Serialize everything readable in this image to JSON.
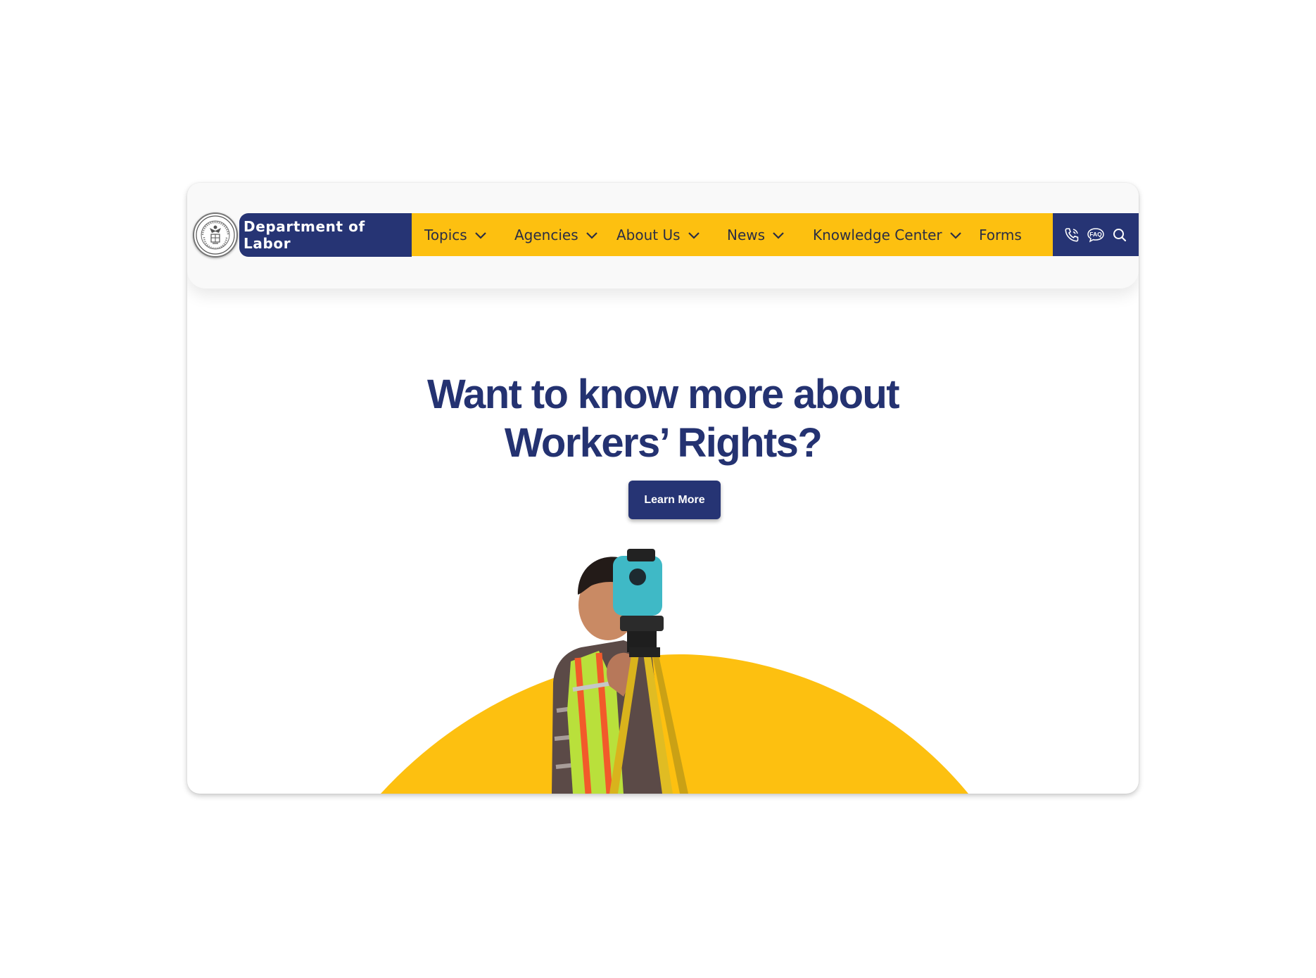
{
  "header": {
    "brand": "Department of Labor",
    "nav": [
      {
        "label": "Topics",
        "dropdown": true
      },
      {
        "label": "Agencies",
        "dropdown": true
      },
      {
        "label": "About Us",
        "dropdown": true
      },
      {
        "label": "News",
        "dropdown": true
      },
      {
        "label": "Knowledge Center",
        "dropdown": true
      },
      {
        "label": "Forms",
        "dropdown": false
      }
    ],
    "utility": {
      "icons": [
        "phone-icon",
        "faq-icon",
        "search-icon"
      ],
      "faq_text": "FAQ"
    }
  },
  "hero": {
    "title_line1": "Want to know more about",
    "title_line2": "Workers’ Rights?",
    "cta_label": "Learn More"
  },
  "colors": {
    "navy": "#263474",
    "yellow": "#fdc010",
    "title": "#243271"
  }
}
